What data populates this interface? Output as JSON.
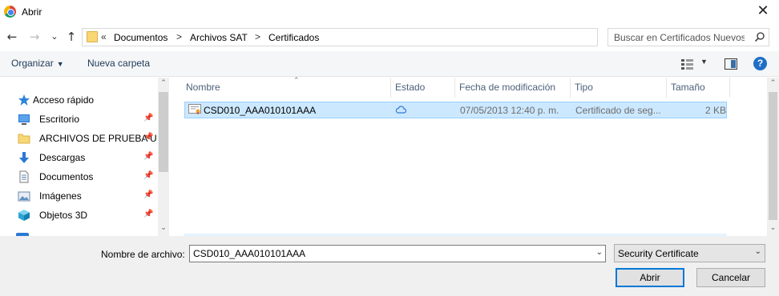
{
  "window": {
    "title": "Abrir",
    "close_glyph": "✕"
  },
  "nav_buttons": {
    "back": "←",
    "forward": "→",
    "recent": "⌄",
    "up": "↑"
  },
  "address": {
    "overflow": "«",
    "crumbs": [
      "Documentos",
      "Archivos SAT",
      "Certificados"
    ],
    "separator": ">",
    "dropdown": "⌄",
    "refresh": "↻"
  },
  "search": {
    "placeholder": "Buscar en Certificados Nuevos"
  },
  "toolbar": {
    "organize_label": "Organizar",
    "organize_caret": "▼",
    "new_folder_label": "Nueva carpeta",
    "view_caret": "▼",
    "help_glyph": "?"
  },
  "nav_pane": {
    "items": [
      {
        "label": "Acceso rápido",
        "icon": "star-icon"
      },
      {
        "label": "Escritorio",
        "icon": "desktop-icon",
        "pinned": true
      },
      {
        "label": "ARCHIVOS DE PRUEBA U",
        "icon": "folder-icon",
        "pinned": true
      },
      {
        "label": "Descargas",
        "icon": "download-icon",
        "pinned": true
      },
      {
        "label": "Documentos",
        "icon": "documents-icon",
        "pinned": true
      },
      {
        "label": "Imágenes",
        "icon": "pictures-icon",
        "pinned": true
      },
      {
        "label": "Objetos 3D",
        "icon": "objects-3d-icon",
        "pinned": true
      }
    ],
    "pin_glyph": "📌"
  },
  "file_list": {
    "columns": [
      "Nombre",
      "Estado",
      "Fecha de modificación",
      "Tipo",
      "Tamaño"
    ],
    "sort_glyph": "⌃",
    "rows": [
      {
        "name": "CSD010_AAA010101AAA",
        "status_icon": "cloud-icon",
        "modified": "07/05/2013 12:40 p. m.",
        "type": "Certificado de seg...",
        "size": "2 KB",
        "selected": true
      }
    ]
  },
  "scroll": {
    "up": "⌃",
    "down": "⌄"
  },
  "bottom": {
    "filename_label": "Nombre de archivo:",
    "filename_value": "CSD010_AAA010101AAA",
    "filename_dropdown": "⌄",
    "filetype_value": "Security Certificate",
    "filetype_dropdown": "⌄",
    "open_label": "Abrir",
    "cancel_label": "Cancelar"
  },
  "colors": {
    "selection": "#cce8ff",
    "selection_border": "#99d1ff",
    "accent": "#0078d7"
  }
}
